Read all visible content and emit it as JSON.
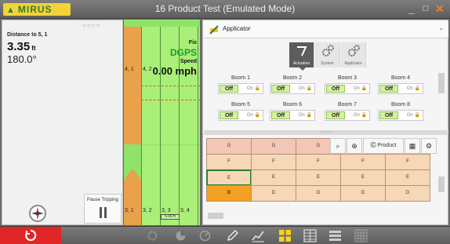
{
  "titlebar": {
    "logo": "MIRUS",
    "title": "16 Product Test (Emulated Mode)",
    "minimize_glyph": "_",
    "maximize_glyph": "□",
    "close_glyph": "✕"
  },
  "left_panel": {
    "grip": "○○○○",
    "distance_label": "Distance to 5, 1",
    "distance_value": "3.35",
    "distance_unit": "ft",
    "heading_value": "180.0°",
    "pause_label": "Pause Tripping"
  },
  "map": {
    "fix_label": "Fix",
    "fix_value": "DGPS",
    "speed_label": "Speed",
    "speed_value": "0.00 mph",
    "labels_top": [
      "4, 1",
      "4, 2"
    ],
    "labels_bottom": [
      "3, 1",
      "3, 2",
      "3, 3",
      "3, 4"
    ],
    "scale": "5.00 ft"
  },
  "applicator_selector": {
    "value": "Applicator"
  },
  "tabs": [
    {
      "label": "Actuators",
      "icon": "actuator-icon",
      "active": true
    },
    {
      "label": "System",
      "icon": "gears-icon",
      "active": false
    },
    {
      "label": "Applicator",
      "icon": "gears-icon",
      "active": false
    }
  ],
  "booms": [
    {
      "name": "Boom 1",
      "off": "Off",
      "on": "On"
    },
    {
      "name": "Boom 2",
      "off": "Off",
      "on": "On"
    },
    {
      "name": "Boom 3",
      "off": "Off",
      "on": "On"
    },
    {
      "name": "Boom 4",
      "off": "Off",
      "on": "On"
    },
    {
      "name": "Boom 5",
      "off": "Off",
      "on": "On"
    },
    {
      "name": "Boom 6",
      "off": "Off",
      "on": "On"
    },
    {
      "name": "Boom 7",
      "off": "Off",
      "on": "On"
    },
    {
      "name": "Boom 8",
      "off": "Off",
      "on": "On"
    }
  ],
  "splitter_grip": "○○○○",
  "grid_rows": [
    {
      "cells": [
        "G",
        "G",
        "G",
        "G",
        "G"
      ]
    },
    {
      "cells": [
        "F",
        "F",
        "F",
        "F",
        "F"
      ]
    },
    {
      "cells": [
        "E",
        "E",
        "E",
        "E",
        "E"
      ]
    },
    {
      "cells": [
        "D",
        "D",
        "D",
        "D",
        "D"
      ]
    }
  ],
  "grid_tools": {
    "zoom_out": "⌕",
    "zoom_in": "⊕",
    "product_label": "Product",
    "grid_glyph": "▦",
    "settings_glyph": "⚙"
  },
  "colors": {
    "accent_green": "#8fe26a",
    "map_orange": "#e9a24a",
    "home_red": "#e02626",
    "active_yellow": "#ffd21a",
    "cell_g": "#f3c7b8",
    "cell_f": "#f6d7b6",
    "cell_e": "#f6d7b6",
    "cell_d": "#f6d7b6",
    "cell_d_first": "#f4a022"
  },
  "bottombar_icons": [
    "home-icon",
    "gear-icon",
    "chart-pie-icon",
    "gauge-icon",
    "pencil-icon",
    "line-chart-icon",
    "grid-4-icon",
    "grid-8-icon",
    "list-icon",
    "grid-16-icon"
  ]
}
